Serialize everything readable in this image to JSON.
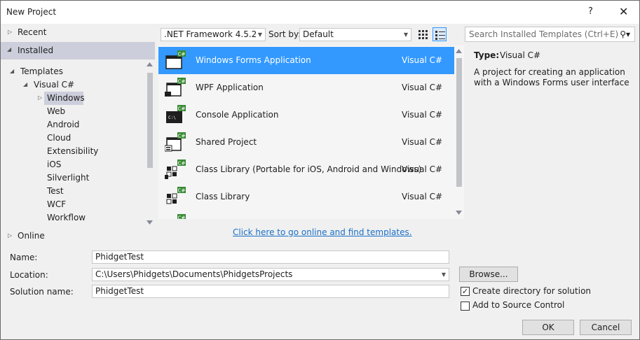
{
  "window": {
    "title": "New Project",
    "help": "?",
    "close": "✕"
  },
  "tree": {
    "recent": "Recent",
    "installed": "Installed",
    "templates": "Templates",
    "visual_csharp": "Visual C#",
    "children": [
      "Windows",
      "Web",
      "Android",
      "Cloud",
      "Extensibility",
      "iOS",
      "Silverlight",
      "Test",
      "WCF",
      "Workflow"
    ],
    "online": "Online"
  },
  "toolbar": {
    "framework": ".NET Framework 4.5.2",
    "sort_label": "Sort by:",
    "sort_value": "Default",
    "search_placeholder": "Search Installed Templates (Ctrl+E)"
  },
  "templates": [
    {
      "name": "Windows Forms Application",
      "lang": "Visual C#",
      "icon": "windows-forms-icon"
    },
    {
      "name": "WPF Application",
      "lang": "Visual C#",
      "icon": "wpf-icon"
    },
    {
      "name": "Console Application",
      "lang": "Visual C#",
      "icon": "console-icon"
    },
    {
      "name": "Shared Project",
      "lang": "Visual C#",
      "icon": "shared-project-icon"
    },
    {
      "name": "Class Library (Portable for iOS, Android and Windows)",
      "lang": "Visual C#",
      "icon": "portable-library-icon"
    },
    {
      "name": "Class Library",
      "lang": "Visual C#",
      "icon": "class-library-icon"
    }
  ],
  "online_link": "Click here to go online and find templates.",
  "details": {
    "type_label": "Type:",
    "type_value": "Visual C#",
    "description": "A project for creating an application with a Windows Forms user interface"
  },
  "form": {
    "name_label": "Name:",
    "name_value": "PhidgetTest",
    "location_label": "Location:",
    "location_value": "C:\\Users\\Phidgets\\Documents\\PhidgetsProjects",
    "solution_label": "Solution name:",
    "solution_value": "PhidgetTest",
    "browse": "Browse...",
    "create_dir": "Create directory for solution",
    "source_control": "Add to Source Control",
    "ok": "OK",
    "cancel": "Cancel"
  },
  "colors": {
    "accent": "#3399ff",
    "selection_gray": "#cccedb",
    "link": "#1a6fc7",
    "csharp_green": "#388a34"
  }
}
